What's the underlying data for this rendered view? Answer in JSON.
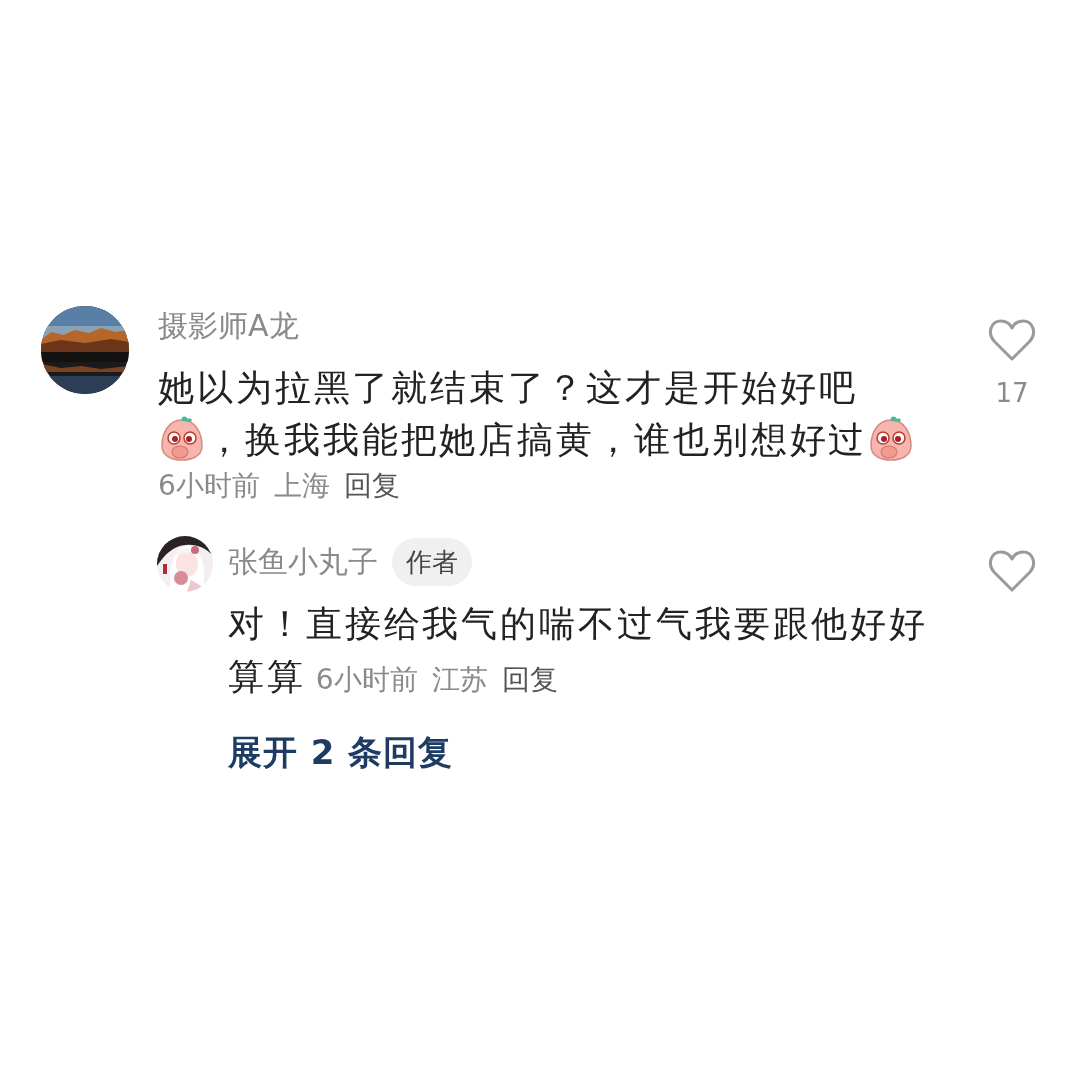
{
  "comments": [
    {
      "author": "摄影师A龙",
      "content": [
        {
          "kind": "text",
          "text": "她以为拉黑了就结束了？这才是开始好吧"
        },
        {
          "kind": "sticker"
        },
        {
          "kind": "text",
          "text": "，换我我能把她店搞黄，谁也别想好过"
        },
        {
          "kind": "sticker"
        }
      ],
      "time": "6小时前",
      "location": "上海",
      "reply_label": "回复",
      "likes": "17",
      "replies": [
        {
          "author": "张鱼小丸子",
          "badge": "作者",
          "content": [
            {
              "kind": "text",
              "text": "对！直接给我气的喘不过气我要跟他好好算算"
            }
          ],
          "time": "6小时前",
          "location": "江苏",
          "reply_label": "回复"
        }
      ],
      "expand_label": "展开 2 条回复"
    }
  ]
}
